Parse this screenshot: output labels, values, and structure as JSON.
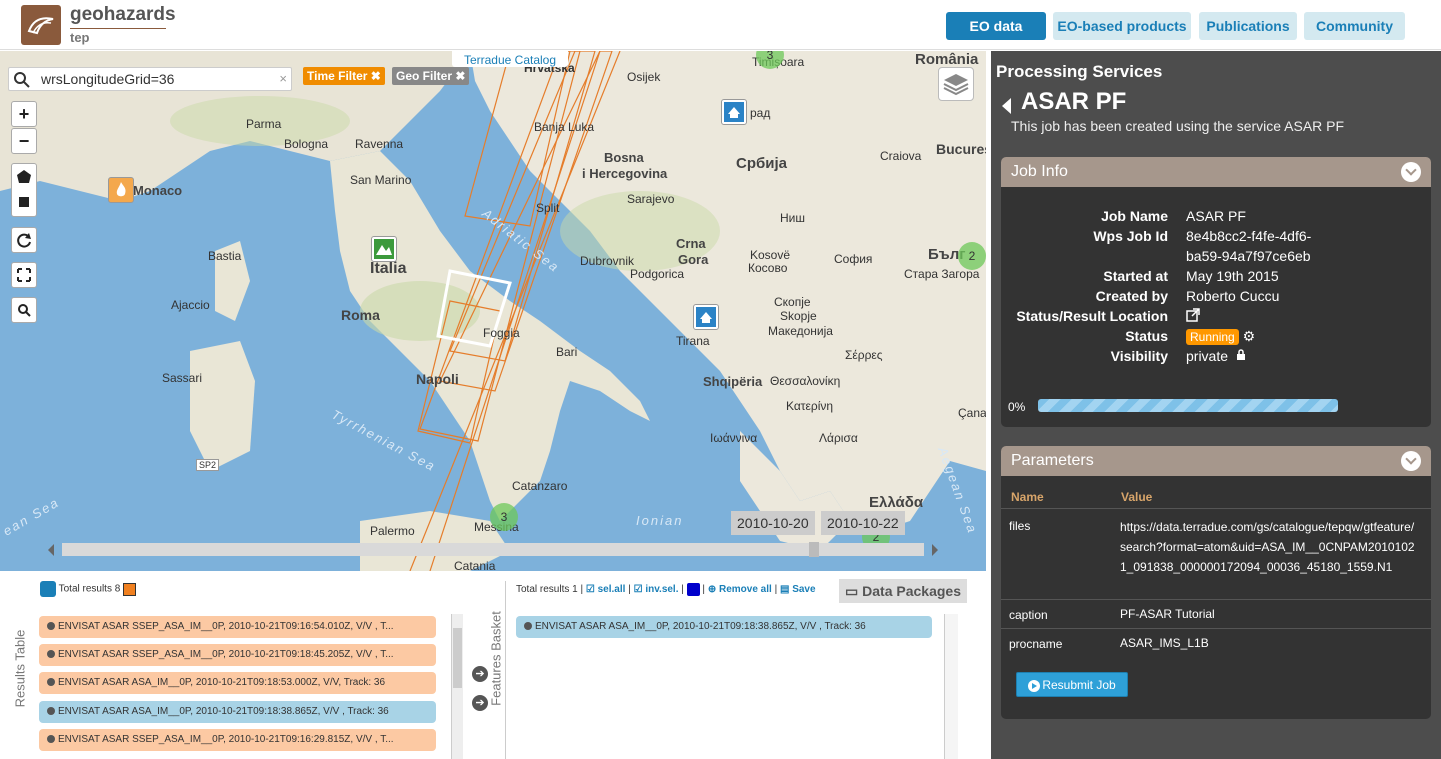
{
  "header": {
    "logo_title": "geohazards",
    "logo_sub": "tep",
    "nav": [
      {
        "label": "EO data",
        "active": true
      },
      {
        "label": "EO-based products",
        "active": false
      },
      {
        "label": "Publications",
        "active": false
      },
      {
        "label": "Community",
        "active": false
      }
    ]
  },
  "map": {
    "search_value": "wrsLongitudeGrid=36",
    "search_clear": "×",
    "filters": [
      {
        "label": "Time Filter ✖",
        "color": "#f08c00"
      },
      {
        "label": "Geo Filter ✖",
        "color": "#888888"
      }
    ],
    "catalog_tab": "Terradue Catalog",
    "controls": [
      "+",
      "−"
    ],
    "places": {
      "hrvatska": "Hrvatska",
      "romania": "România",
      "osijek": "Osijek",
      "timisoara": "Timișoara",
      "banja_luka": "Banja Luka",
      "beograd": "рад",
      "parma": "Parma",
      "bologna": "Bologna",
      "ravenna": "Ravenna",
      "bosna": "Bosna",
      "hercegovina": "i Hercegovina",
      "srbija": "Србија",
      "craiova": "Craiova",
      "bucuresti": "Bucures",
      "monaco": "Monaco",
      "san_marino": "San Marino",
      "split": "Split",
      "sarajevo": "Sarajevo",
      "nis": "Ниш",
      "italia": "Italia",
      "bastia": "Bastia",
      "crna_gora": "Crna",
      "gora": "Gora",
      "kosove": "Kosovë",
      "kosovo": "Косово",
      "sofia": "София",
      "bulgaria": "Бълг",
      "stara_zagora": "Стара Загора",
      "dubrovnik": "Dubrovnik",
      "podgorica": "Podgorica",
      "ajaccio": "Ajaccio",
      "roma": "Roma",
      "foggia": "Foggia",
      "skopje": "Скопје",
      "skopje_lat": "Skopje",
      "makedonija": "Македонија",
      "tirana": "Tirana",
      "bari": "Bari",
      "serres": "Σέρρες",
      "sassari": "Sassari",
      "napoli": "Napoli",
      "shqiperia": "Shqipëria",
      "thessaloniki": "Θεσσαλονίκη",
      "katerini": "Κατερίνη",
      "canak": "Çana",
      "ioannina": "Ιωάννινα",
      "larisa": "Λάρισα",
      "catanzaro": "Catanzaro",
      "ellada": "Ελλάδα",
      "palermo": "Palermo",
      "messina": "Messina",
      "catania": "Catania",
      "sp2": "SP2",
      "adriatic": "Adriatic Sea",
      "tyrrhenian": "Tyrrhenian Sea",
      "ionian": "Ionian",
      "aegean": "Aegean Sea",
      "rean": "ean Sea"
    },
    "clusters": [
      "3",
      "3",
      "2",
      "2"
    ],
    "timeline_dates": [
      "2010-10-20",
      "2010-10-22"
    ]
  },
  "results": {
    "tab_label": "Results Table",
    "total_label": "Total results  8",
    "items": [
      {
        "text": "ENVISAT ASAR SSEP_ASA_IM__0P, 2010-10-21T09:16:54.010Z, V/V , T...",
        "style": "orange"
      },
      {
        "text": "ENVISAT ASAR SSEP_ASA_IM__0P, 2010-10-21T09:18:45.205Z, V/V , T...",
        "style": "orange"
      },
      {
        "text": "ENVISAT ASAR ASA_IM__0P, 2010-10-21T09:18:53.000Z, V/V, Track: 36",
        "style": "orange"
      },
      {
        "text": "ENVISAT ASAR ASA_IM__0P, 2010-10-21T09:18:38.865Z, V/V , Track: 36",
        "style": "blue"
      },
      {
        "text": "ENVISAT ASAR SSEP_ASA_IM__0P, 2010-10-21T09:16:29.815Z, V/V , T...",
        "style": "orange"
      }
    ]
  },
  "basket": {
    "tab_label": "Features Basket",
    "total_label": "Total results  1 |",
    "sel_all": "sel.all",
    "inv_sel": "inv.sel.",
    "remove_all": "Remove all",
    "save": "Save",
    "data_packages": "Data Packages",
    "item": "ENVISAT ASAR ASA_IM__0P, 2010-10-21T09:18:38.865Z, V/V , Track: 36"
  },
  "panel": {
    "title": "Processing Services",
    "job_title": "ASAR PF",
    "description": "This job has been created using the service ASAR PF",
    "job_info": {
      "header": "Job Info",
      "rows": [
        {
          "label": "Job Name",
          "value": "ASAR PF"
        },
        {
          "label": "Wps Job Id",
          "value": "8e4b8cc2-f4fe-4df6-",
          "value2": "ba59-94a7f97ce6eb"
        },
        {
          "label": "Started at",
          "value": "May 19th 2015"
        },
        {
          "label": "Created by",
          "value": "Roberto Cuccu"
        },
        {
          "label": "Status/Result Location",
          "value": ""
        },
        {
          "label": "Status",
          "value": "Running"
        },
        {
          "label": "Visibility",
          "value": "private"
        }
      ],
      "progress_pct": "0%",
      "progress": 0
    },
    "parameters": {
      "header": "Parameters",
      "col_name": "Name",
      "col_value": "Value",
      "rows": [
        {
          "name": "files",
          "value": "https://data.terradue.com/gs/catalogue/tepqw/gtfeature/search?format=atom&uid=ASA_IM__0CNPAM20101021_091838_000000172094_00036_45180_1559.N1"
        },
        {
          "name": "caption",
          "value": "PF-ASAR Tutorial"
        },
        {
          "name": "procname",
          "value": "ASAR_IMS_L1B"
        }
      ],
      "resubmit": "Resubmit Job"
    }
  }
}
